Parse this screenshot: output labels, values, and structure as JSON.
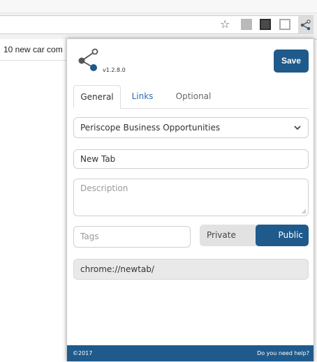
{
  "browser": {
    "bookmark_icon": "star-icon",
    "extensions": [
      "pdf-icon",
      "note-icon",
      "grey-extension-icon",
      "share-icon"
    ]
  },
  "background_page": {
    "link_text": "10 new car com"
  },
  "popup": {
    "version": "v1.2.8.0",
    "save_label": "Save",
    "tabs": [
      {
        "label": "General"
      },
      {
        "label": "Links"
      },
      {
        "label": "Optional"
      }
    ],
    "select_value": "Periscope Business Opportunities",
    "title_value": "New Tab",
    "description_placeholder": "Description",
    "tags_placeholder": "Tags",
    "visibility": {
      "private_label": "Private",
      "public_label": "Public",
      "selected": "Public"
    },
    "url_value": "chrome://newtab/",
    "footer": {
      "copyright": "©2017",
      "help": "Do you need help?"
    }
  },
  "colors": {
    "accent": "#1f5a8c",
    "link": "#2a6fb1",
    "readonly_bg": "#e9e9e9"
  }
}
